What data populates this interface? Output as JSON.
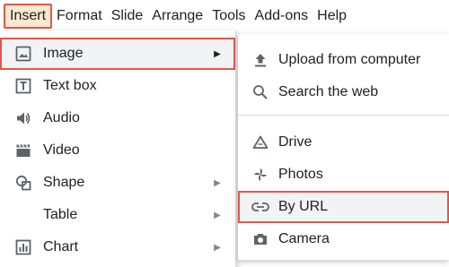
{
  "menubar": {
    "items": [
      {
        "label": "Insert"
      },
      {
        "label": "Format"
      },
      {
        "label": "Slide"
      },
      {
        "label": "Arrange"
      },
      {
        "label": "Tools"
      },
      {
        "label": "Add-ons"
      },
      {
        "label": "Help"
      }
    ],
    "active": "Insert"
  },
  "insert_menu": {
    "items": [
      {
        "label": "Image",
        "icon": "image-icon",
        "submenu": true
      },
      {
        "label": "Text box",
        "icon": "text-box-icon",
        "submenu": false
      },
      {
        "label": "Audio",
        "icon": "audio-icon",
        "submenu": false
      },
      {
        "label": "Video",
        "icon": "video-icon",
        "submenu": false
      },
      {
        "label": "Shape",
        "icon": "shape-icon",
        "submenu": true
      },
      {
        "label": "Table",
        "icon": "",
        "submenu": true
      },
      {
        "label": "Chart",
        "icon": "chart-icon",
        "submenu": true
      }
    ],
    "arrow_glyph": "▶"
  },
  "image_submenu": {
    "items": [
      {
        "label": "Upload from computer",
        "icon": "upload-icon"
      },
      {
        "label": "Search the web",
        "icon": "search-icon"
      },
      {
        "label": "Drive",
        "icon": "drive-icon"
      },
      {
        "label": "Photos",
        "icon": "photos-icon"
      },
      {
        "label": "By URL",
        "icon": "link-icon"
      },
      {
        "label": "Camera",
        "icon": "camera-icon"
      }
    ]
  },
  "colors": {
    "highlight_border": "#e2574c",
    "active_menu_bg": "#fce8cf",
    "selected_bg": "#f1f3f4",
    "icon": "#5f6368",
    "text": "#202124"
  }
}
